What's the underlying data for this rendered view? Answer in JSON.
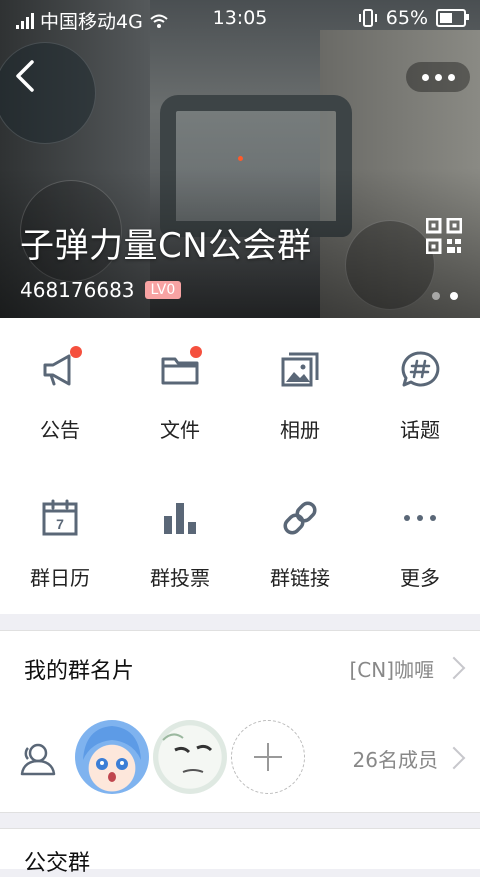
{
  "status_bar": {
    "carrier": "中国移动4G",
    "time": "13:05",
    "battery": "65%",
    "battery_level": 0.65
  },
  "header": {
    "group_name": "子弹力量CN公会群",
    "group_id": "468176683",
    "level_badge": "LV0",
    "pager_pages": 2,
    "pager_active": 2
  },
  "grid": {
    "items": [
      {
        "label": "公告",
        "icon": "megaphone-icon",
        "badge": true
      },
      {
        "label": "文件",
        "icon": "folder-icon",
        "badge": true
      },
      {
        "label": "相册",
        "icon": "photo-album-icon",
        "badge": false
      },
      {
        "label": "话题",
        "icon": "hashtag-chat-icon",
        "badge": false
      },
      {
        "label": "群日历",
        "icon": "calendar-icon",
        "badge": false
      },
      {
        "label": "群投票",
        "icon": "bar-chart-icon",
        "badge": false
      },
      {
        "label": "群链接",
        "icon": "link-icon",
        "badge": false
      },
      {
        "label": "更多",
        "icon": "more-dots-icon",
        "badge": false
      }
    ]
  },
  "my_card": {
    "title": "我的群名片",
    "value": "[CN]咖喱"
  },
  "members": {
    "count_label": "26名成员"
  },
  "next_row": {
    "title": "公交群"
  },
  "colors": {
    "badge": "#f5503e",
    "icon": "#5a6777",
    "level_badge": "#f8a3a3"
  }
}
